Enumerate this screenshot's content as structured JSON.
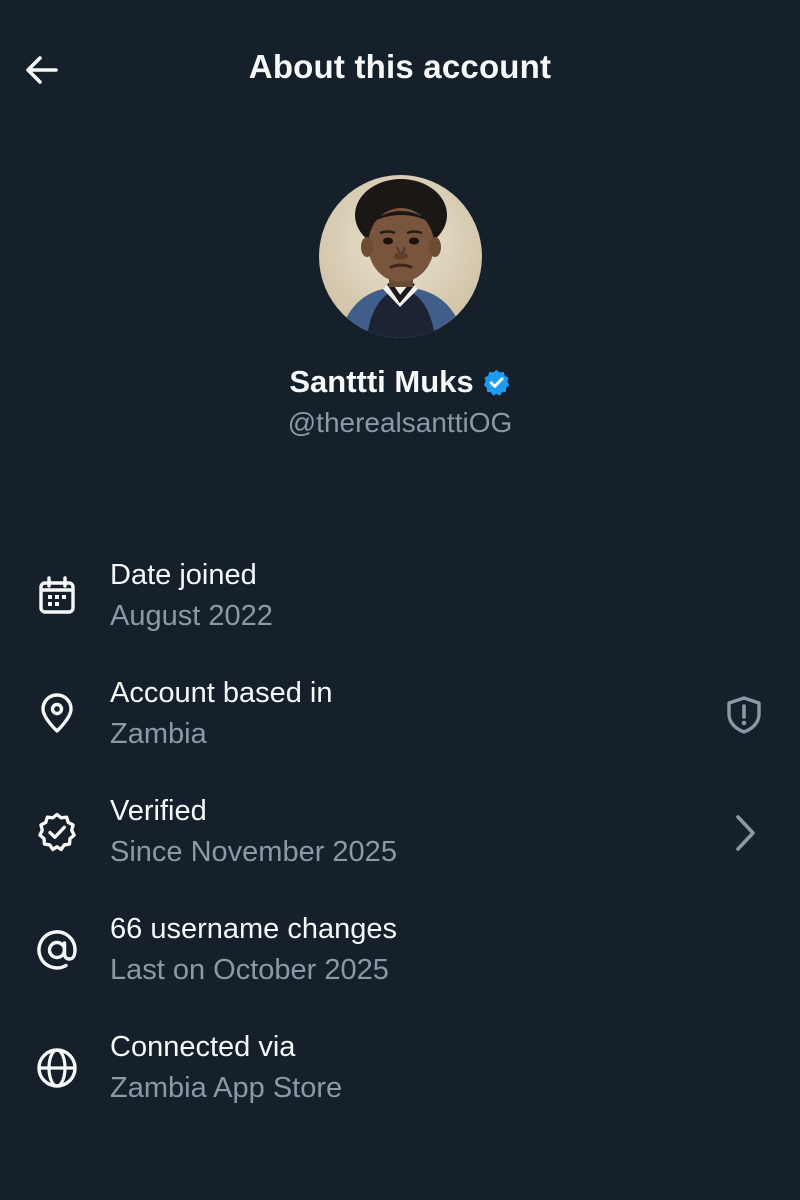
{
  "header": {
    "title": "About this account",
    "back_icon": "arrow-left-icon"
  },
  "profile": {
    "display_name": "Santtti Muks",
    "handle": "@therealsanttiOG",
    "verified": true,
    "badge_color": "#1d9bf0"
  },
  "info": [
    {
      "icon": "calendar-icon",
      "label": "Date joined",
      "value": "August 2022"
    },
    {
      "icon": "location-pin-icon",
      "label": "Account based in",
      "value": "Zambia",
      "trailing_icon": "shield-alert-icon"
    },
    {
      "icon": "verified-badge-outline-icon",
      "label": "Verified",
      "value": "Since November 2025",
      "trailing_icon": "chevron-right-icon"
    },
    {
      "icon": "at-sign-icon",
      "label": "66 username changes",
      "value": "Last on October 2025"
    },
    {
      "icon": "globe-icon",
      "label": "Connected via",
      "value": "Zambia App Store"
    }
  ],
  "colors": {
    "background": "#15202b",
    "primary_text": "#f7f9f9",
    "secondary_text": "#8b98a5",
    "accent": "#1d9bf0"
  }
}
